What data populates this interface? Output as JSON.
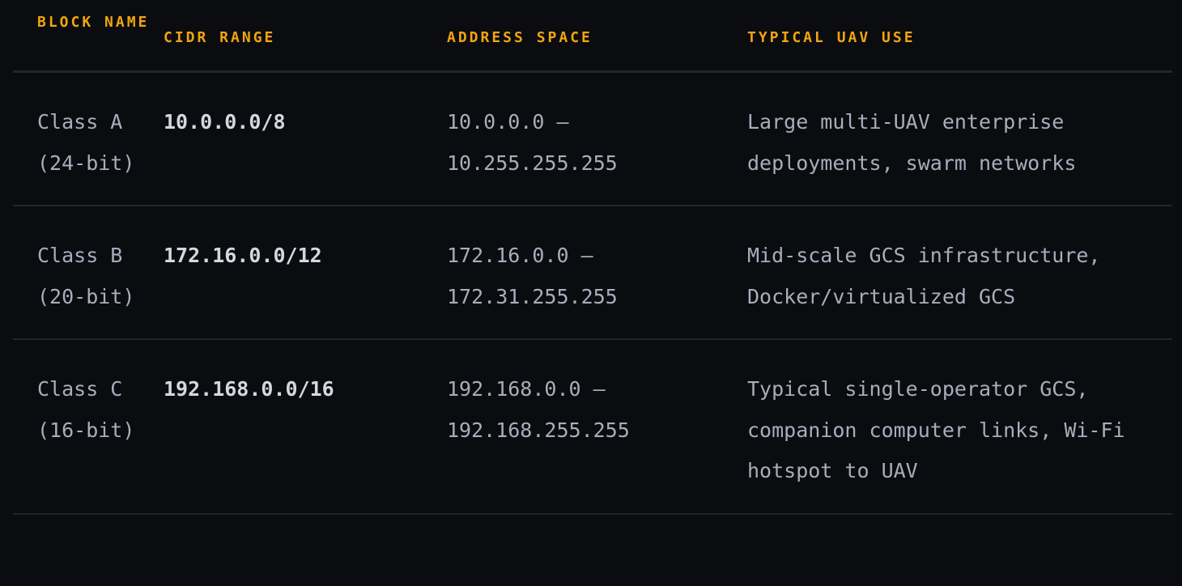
{
  "table": {
    "headers": [
      "BLOCK NAME",
      "CIDR RANGE",
      "ADDRESS SPACE",
      "TYPICAL UAV USE"
    ],
    "rows": [
      {
        "block_name": "Class A (24-bit)",
        "cidr": "10.0.0.0/8",
        "address_space": "10.0.0.0 – 10.255.255.255",
        "use": "Large multi-UAV enterprise deployments, swarm networks"
      },
      {
        "block_name": "Class B (20-bit)",
        "cidr": "172.16.0.0/12",
        "address_space": "172.16.0.0 – 172.31.255.255",
        "use": "Mid-scale GCS infrastructure, Docker/virtualized GCS"
      },
      {
        "block_name": "Class C (16-bit)",
        "cidr": "192.168.0.0/16",
        "address_space": "192.168.0.0 – 192.168.255.255",
        "use": "Typical single-operator GCS, companion computer links, Wi-Fi hotspot to UAV"
      }
    ]
  },
  "colors": {
    "background": "#0b0c10",
    "header_accent": "#f2a50c",
    "body_text": "#a7aebb",
    "cidr_text": "#d3d8e0",
    "divider": "#22252c"
  }
}
